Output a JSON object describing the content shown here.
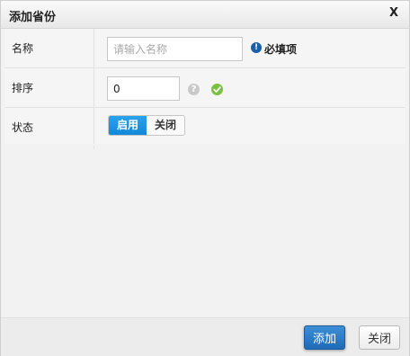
{
  "dialog": {
    "title": "添加省份",
    "close_label": "X"
  },
  "form": {
    "name": {
      "label": "名称",
      "value": "",
      "placeholder": "请输入名称",
      "required_text": "必填项",
      "required_icon": "!"
    },
    "sort": {
      "label": "排序",
      "value": "0",
      "help_icon": "?"
    },
    "status": {
      "label": "状态",
      "on_label": "启用",
      "off_label": "关闭",
      "selected": "启用"
    }
  },
  "footer": {
    "submit_label": "添加",
    "close_label": "关闭"
  },
  "colors": {
    "accent": "#1288d6",
    "primary_button": "#1e6bb8",
    "success": "#7ac143",
    "info": "#1a5fa8"
  },
  "icons": {
    "close": "close-icon",
    "required": "info-icon",
    "help": "help-icon",
    "ok": "check-icon"
  }
}
